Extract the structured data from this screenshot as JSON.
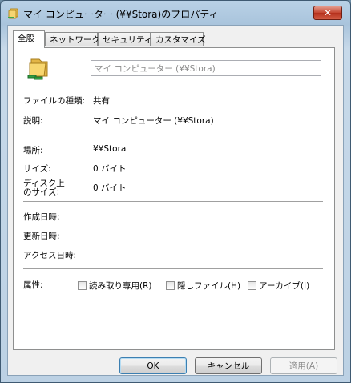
{
  "window": {
    "title": "マイ コンピューター (¥¥Stora)のプロパティ",
    "close_glyph": "✕"
  },
  "tabs": [
    {
      "label": "全般",
      "active": true
    },
    {
      "label": "ネットワーク",
      "active": false
    },
    {
      "label": "セキュリティ",
      "active": false
    },
    {
      "label": "カスタマイズ",
      "active": false
    }
  ],
  "general": {
    "name_value": "マイ コンピューター (¥¥Stora)",
    "rows": {
      "file_type": {
        "label": "ファイルの種類:",
        "value": "共有"
      },
      "description": {
        "label": "説明:",
        "value": "マイ コンピューター (¥¥Stora)"
      },
      "location": {
        "label": "場所:",
        "value": "¥¥Stora"
      },
      "size": {
        "label": "サイズ:",
        "value": "0 バイト"
      },
      "size_on_disk": {
        "label_line1": "ディスク上",
        "label_line2": "のサイズ:",
        "value": "0 バイト"
      },
      "created": {
        "label": "作成日時:"
      },
      "modified": {
        "label": "更新日時:"
      },
      "accessed": {
        "label": "アクセス日時:"
      }
    },
    "attributes": {
      "label": "属性:",
      "readonly": "読み取り専用(R)",
      "hidden": "隠しファイル(H)",
      "archive": "アーカイブ(I)"
    }
  },
  "buttons": {
    "ok": "OK",
    "cancel": "キャンセル",
    "apply": "適用(A)"
  },
  "icons": {
    "title": "network-folder-icon",
    "large": "network-share-folder-icon"
  }
}
